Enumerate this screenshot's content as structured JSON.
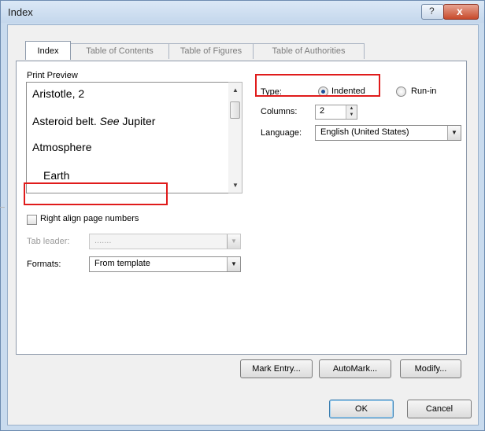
{
  "window": {
    "title": "Index",
    "help_glyph": "?",
    "close_glyph": "x"
  },
  "tabs": [
    "Index",
    "Table of Contents",
    "Table of Figures",
    "Table of Authorities"
  ],
  "print_preview": {
    "label": "Print Preview",
    "entries": [
      {
        "text": "Aristotle, 2"
      },
      {
        "text": "Asteroid belt. ",
        "see": "See",
        "rest": " Jupiter"
      },
      {
        "text": "Atmosphere"
      },
      {
        "text": "Earth"
      }
    ]
  },
  "type_field": {
    "label": "Type:",
    "options": [
      "Indented",
      "Run-in"
    ],
    "selected": "Indented"
  },
  "columns": {
    "label": "Columns:",
    "value": "2"
  },
  "language": {
    "label": "Language:",
    "value": "English (United States)"
  },
  "right_align": {
    "label": "Right align page numbers",
    "checked": false
  },
  "tab_leader": {
    "label": "Tab leader:",
    "value": "......."
  },
  "formats": {
    "label": "Formats:",
    "value": "From template"
  },
  "buttons": {
    "mark_entry": "Mark Entry...",
    "automark": "AutoMark...",
    "modify": "Modify...",
    "ok": "OK",
    "cancel": "Cancel"
  },
  "colors": {
    "highlight": "#e01b1b",
    "title_bar": "#c9dbee",
    "radio_dot": "#1f4e97"
  }
}
